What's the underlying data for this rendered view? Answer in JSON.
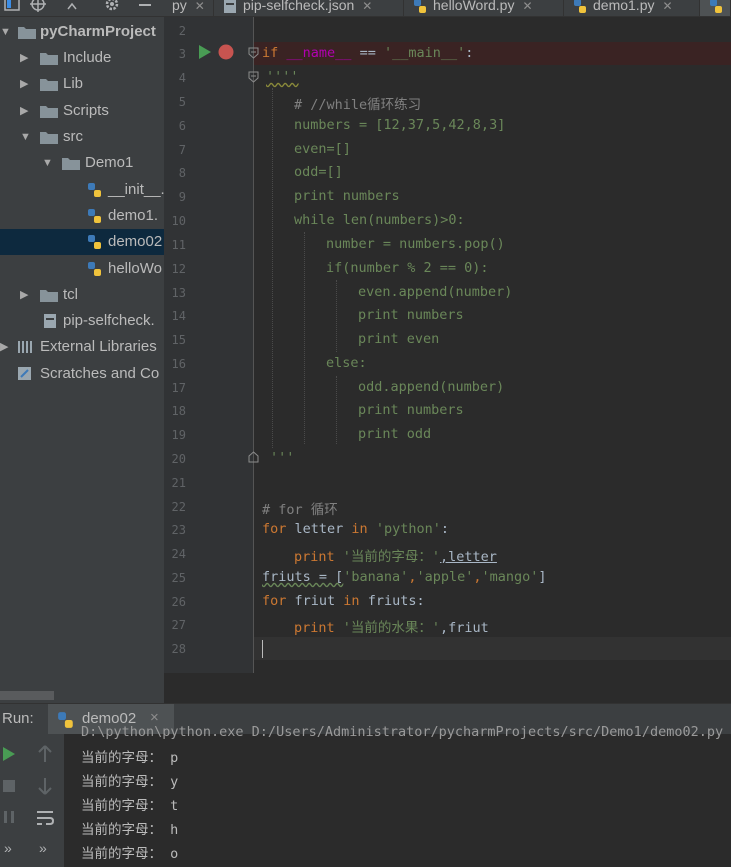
{
  "tabs": [
    {
      "label": "py",
      "icon": "python-file-icon",
      "active": false
    },
    {
      "label": "pip-selfcheck.json",
      "icon": "json-file-icon",
      "active": false
    },
    {
      "label": "helloWord.py",
      "icon": "python-file-icon",
      "active": false
    },
    {
      "label": "demo1.py",
      "icon": "python-file-icon",
      "active": false
    }
  ],
  "project_tree": [
    {
      "label": "pyCharmProject",
      "type": "folder",
      "expanded": true
    },
    {
      "label": "Include",
      "type": "folder",
      "expanded": false
    },
    {
      "label": "Lib",
      "type": "folder",
      "expanded": false
    },
    {
      "label": "Scripts",
      "type": "folder",
      "expanded": false
    },
    {
      "label": "src",
      "type": "folder",
      "expanded": true
    },
    {
      "label": "Demo1",
      "type": "folder",
      "expanded": true
    },
    {
      "label": "__init__.",
      "type": "python-file"
    },
    {
      "label": "demo1.",
      "type": "python-file"
    },
    {
      "label": "demo02",
      "type": "python-file",
      "selected": true
    },
    {
      "label": "helloWo",
      "type": "python-file"
    },
    {
      "label": "tcl",
      "type": "folder",
      "expanded": false
    },
    {
      "label": "pip-selfcheck.",
      "type": "json-file"
    },
    {
      "label": "External Libraries",
      "type": "libraries"
    },
    {
      "label": "Scratches and Co",
      "type": "scratches"
    }
  ],
  "line_numbers": [
    "2",
    "3",
    "4",
    "5",
    "6",
    "7",
    "8",
    "9",
    "10",
    "11",
    "12",
    "13",
    "14",
    "15",
    "16",
    "17",
    "18",
    "19",
    "20",
    "21",
    "22",
    "23",
    "24",
    "25",
    "26",
    "27",
    "28"
  ],
  "code": {
    "l3": {
      "kw": "if",
      "name": "__name__",
      "op": " == ",
      "str": "'__main__'",
      "colon": ":"
    },
    "l4": "''''",
    "l5": "# //while循环练习",
    "l6": "numbers = [12,37,5,42,8,3]",
    "l7": "even=[]",
    "l8": "odd=[]",
    "l9": "print numbers",
    "l10": "while len(numbers)>0:",
    "l11": "number = numbers.pop()",
    "l12": "if(number % 2 == 0):",
    "l13": "even.append(number)",
    "l14": "print numbers",
    "l15": "print even",
    "l16": "else:",
    "l17": "odd.append(number)",
    "l18": "print numbers",
    "l19": "print odd",
    "l20": "'''",
    "l22": "# for 循环",
    "l23": {
      "kw1": "for",
      "v": " letter ",
      "kw2": "in",
      "str": " 'python'",
      "tail": ":"
    },
    "l24": {
      "kw": "print",
      "str": " '当前的字母：'",
      "tail": ",letter"
    },
    "l25": {
      "a": "friuts = [",
      "s1": "'banana'",
      "c1": ",",
      "s2": "'apple'",
      "c2": ",",
      "s3": "'mango'",
      "b": "]"
    },
    "l26": {
      "kw1": "for",
      "v": " friut ",
      "kw2": "in",
      "tail": " friuts:"
    },
    "l27": {
      "kw": "print",
      "str": " '当前的水果：'",
      "tail": ",friut"
    }
  },
  "run": {
    "label": "Run:",
    "tab_label": "demo02",
    "close": "×",
    "command_line": "D:\\python\\python.exe D:/Users/Administrator/pycharmProjects/src/Demo1/demo02.py",
    "output": [
      "当前的字母： p",
      "当前的字母： y",
      "当前的字母： t",
      "当前的字母： h",
      "当前的字母： o"
    ],
    "more": "»"
  },
  "colors": {
    "keyword": "#cc7832",
    "string": "#6a8759",
    "comment": "#808080",
    "dunder": "#b200b2",
    "breakpoint": "#c75450",
    "run_green": "#499c54",
    "selection": "#0d293e"
  }
}
